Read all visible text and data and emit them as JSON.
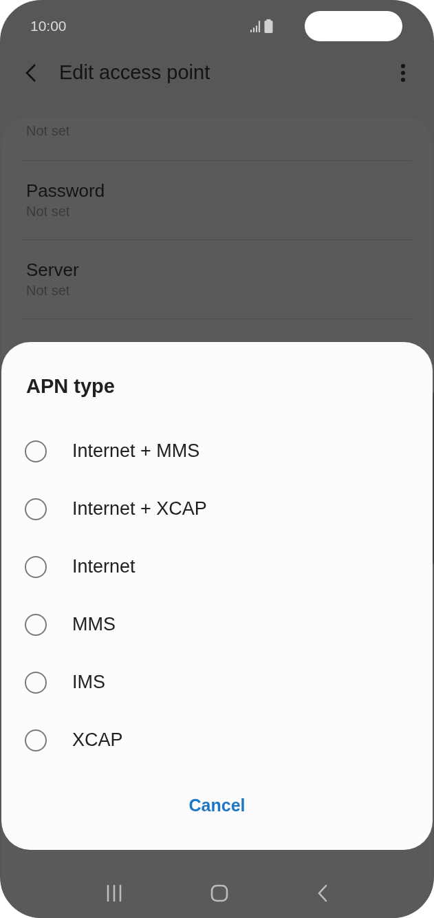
{
  "status_bar": {
    "time": "10:00"
  },
  "toolbar": {
    "title": "Edit access point"
  },
  "settings": [
    {
      "value": "Not set"
    },
    {
      "label": "Password",
      "value": "Not set"
    },
    {
      "label": "Server",
      "value": "Not set"
    }
  ],
  "dialog": {
    "title": "APN type",
    "options": [
      {
        "label": "Internet + MMS",
        "selected": false
      },
      {
        "label": "Internet + XCAP",
        "selected": false
      },
      {
        "label": "Internet",
        "selected": false
      },
      {
        "label": "MMS",
        "selected": false
      },
      {
        "label": "IMS",
        "selected": false
      },
      {
        "label": "XCAP",
        "selected": false
      }
    ],
    "cancel": "Cancel"
  }
}
